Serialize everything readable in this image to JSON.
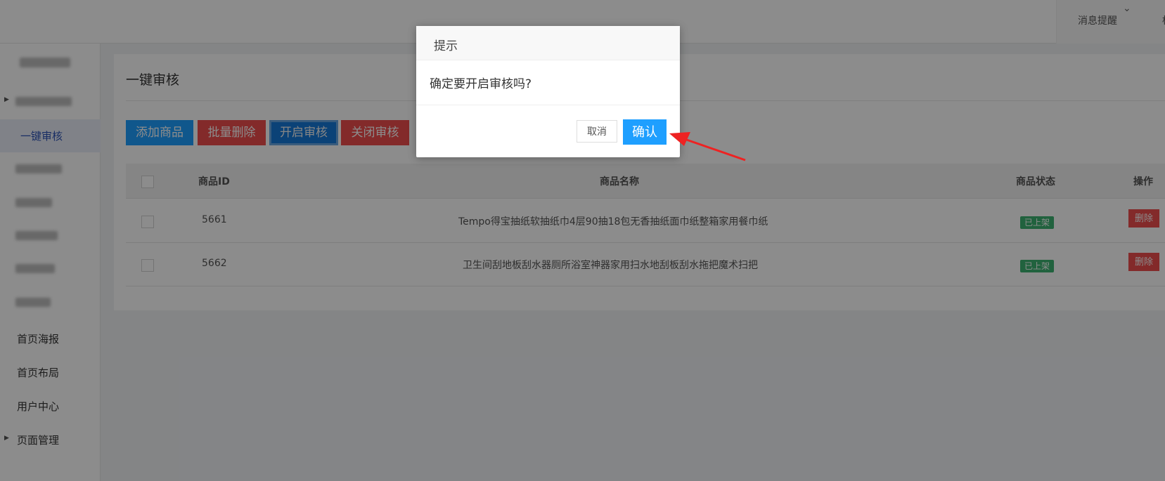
{
  "topbar": {
    "notice_label": "消息提醒",
    "notice_chevron": "⌄",
    "more_text": "标"
  },
  "sidebar": {
    "items": [
      {
        "label": "",
        "blurred": true,
        "caret": true
      },
      {
        "label": "一键审核",
        "active": true
      },
      {
        "label": "",
        "blurred": true
      },
      {
        "label": "",
        "blurred": true
      },
      {
        "label": "",
        "blurred": true
      },
      {
        "label": "",
        "blurred": true
      },
      {
        "label": "",
        "blurred": true
      },
      {
        "label": "首页海报"
      },
      {
        "label": "首页布局"
      },
      {
        "label": "用户中心"
      },
      {
        "label": "页面管理",
        "caret": true
      }
    ]
  },
  "page": {
    "title": "一键审核"
  },
  "toolbar": {
    "add_label": "添加商品",
    "batch_delete_label": "批量删除",
    "enable_review_label": "开启审核",
    "disable_review_label": "关闭审核"
  },
  "table": {
    "headers": {
      "id": "商品ID",
      "name": "商品名称",
      "status": "商品状态",
      "action": "操作"
    },
    "rows": [
      {
        "id": "5661",
        "name": "Tempo得宝抽纸软抽纸巾4层90抽18包无香抽纸面巾纸整箱家用餐巾纸",
        "status": "已上架",
        "action": "删除"
      },
      {
        "id": "5662",
        "name": "卫生间刮地板刮水器厕所浴室神器家用扫水地刮板刮水拖把魔术扫把",
        "status": "已上架",
        "action": "删除"
      }
    ]
  },
  "dialog": {
    "title": "提示",
    "message": "确定要开启审核吗?",
    "cancel_label": "取消",
    "ok_label": "确认"
  },
  "colors": {
    "primary": "#1e9fff",
    "danger": "#ef4d4d",
    "success": "#3cb371",
    "annotation_arrow": "#ee2222"
  }
}
